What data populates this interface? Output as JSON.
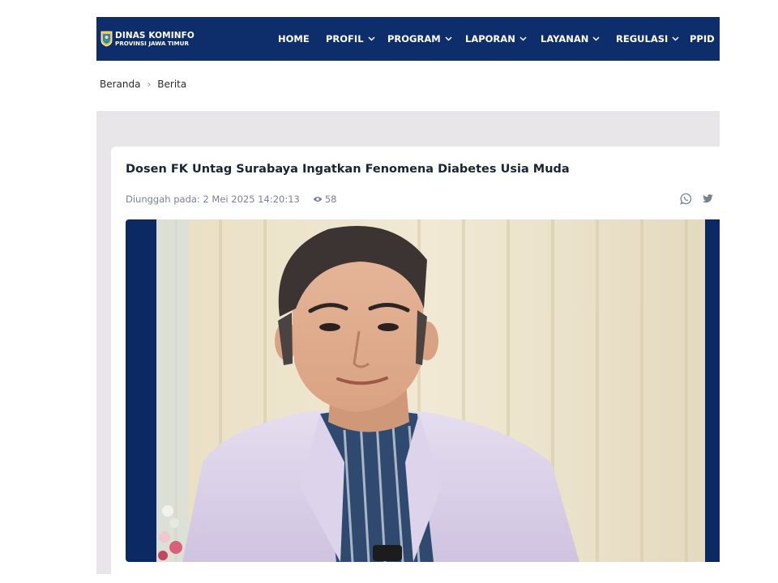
{
  "brand": {
    "title": "DINAS KOMINFO",
    "subtitle": "PROVINSI JAWA TIMUR"
  },
  "nav": {
    "items": [
      {
        "label": "HOME",
        "dropdown": false
      },
      {
        "label": "PROFIL",
        "dropdown": true
      },
      {
        "label": "PROGRAM",
        "dropdown": true
      },
      {
        "label": "LAPORAN",
        "dropdown": true
      },
      {
        "label": "LAYANAN",
        "dropdown": true
      },
      {
        "label": "REGULASI",
        "dropdown": true
      },
      {
        "label": "PPID",
        "dropdown": false
      }
    ]
  },
  "breadcrumb": {
    "home": "Beranda",
    "current": "Berita"
  },
  "article": {
    "title": "Dosen FK Untag Surabaya Ingatkan Fenomena Diabetes Usia Muda",
    "upload_label": "Diunggah pada: 2 Mei 2025 14:20:13",
    "views": "58"
  },
  "share": {
    "icons": [
      "whatsapp-icon",
      "twitter-icon"
    ]
  },
  "colors": {
    "navbar": "#0d2d6b",
    "content_bg": "#e9e6ea",
    "card": "#ffffff"
  }
}
